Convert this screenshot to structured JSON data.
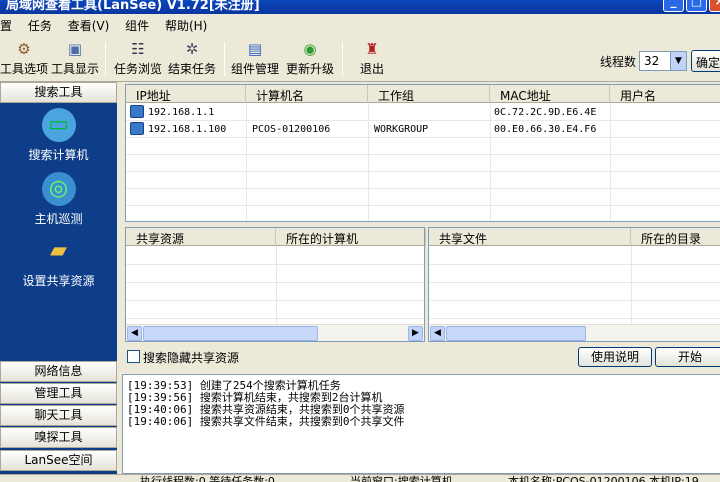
{
  "window": {
    "title": "局域网查看工具(LanSee) V1.72[未注册]"
  },
  "menu": [
    "置",
    "任务",
    "查看(V)",
    "组件",
    "帮助(H)"
  ],
  "toolbar": {
    "items": [
      "工具选项",
      "工具显示",
      "任务浏览",
      "结束任务",
      "组件管理",
      "更新升级",
      "退出"
    ],
    "threads_label": "线程数",
    "threads_value": "32",
    "confirm": "确定"
  },
  "sidebar": {
    "header": "搜索工具",
    "items": [
      "搜索计算机",
      "主机巡测",
      "设置共享资源"
    ],
    "sections": [
      "网络信息",
      "管理工具",
      "聊天工具",
      "嗅探工具",
      "LanSee空间"
    ]
  },
  "hosts_table": {
    "columns": [
      "IP地址",
      "计算机名",
      "工作组",
      "MAC地址",
      "用户名"
    ],
    "rows": [
      {
        "ip": "192.168.1.1",
        "name": "",
        "group": "",
        "mac": "0C.72.2C.9D.E6.4E",
        "user": ""
      },
      {
        "ip": "192.168.1.100",
        "name": "PCOS-01200106",
        "group": "WORKGROUP",
        "mac": "00.E0.66.30.E4.F6",
        "user": ""
      }
    ]
  },
  "share_table": {
    "columns": [
      "共享资源",
      "所在的计算机"
    ]
  },
  "files_table": {
    "columns": [
      "共享文件",
      "所在的目录"
    ]
  },
  "options": {
    "hidden_shares": "搜索隐藏共享资源",
    "help_button": "使用说明",
    "start_button": "开始"
  },
  "log": [
    "[19:39:53] 创建了254个搜索计算机任务",
    "[19:39:56] 搜索计算机结束，共搜索到2台计算机",
    "[19:40:06] 搜索共享资源结束，共搜索到0个共享资源",
    "[19:40:06] 搜索共享文件结束，共搜索到0个共享文件"
  ],
  "status": {
    "left": "执行线程数:0 等待任务数:0",
    "mid": "当前窗口:搜索计算机",
    "right": "本机名称:PCOS-01200106  本机IP:19"
  }
}
